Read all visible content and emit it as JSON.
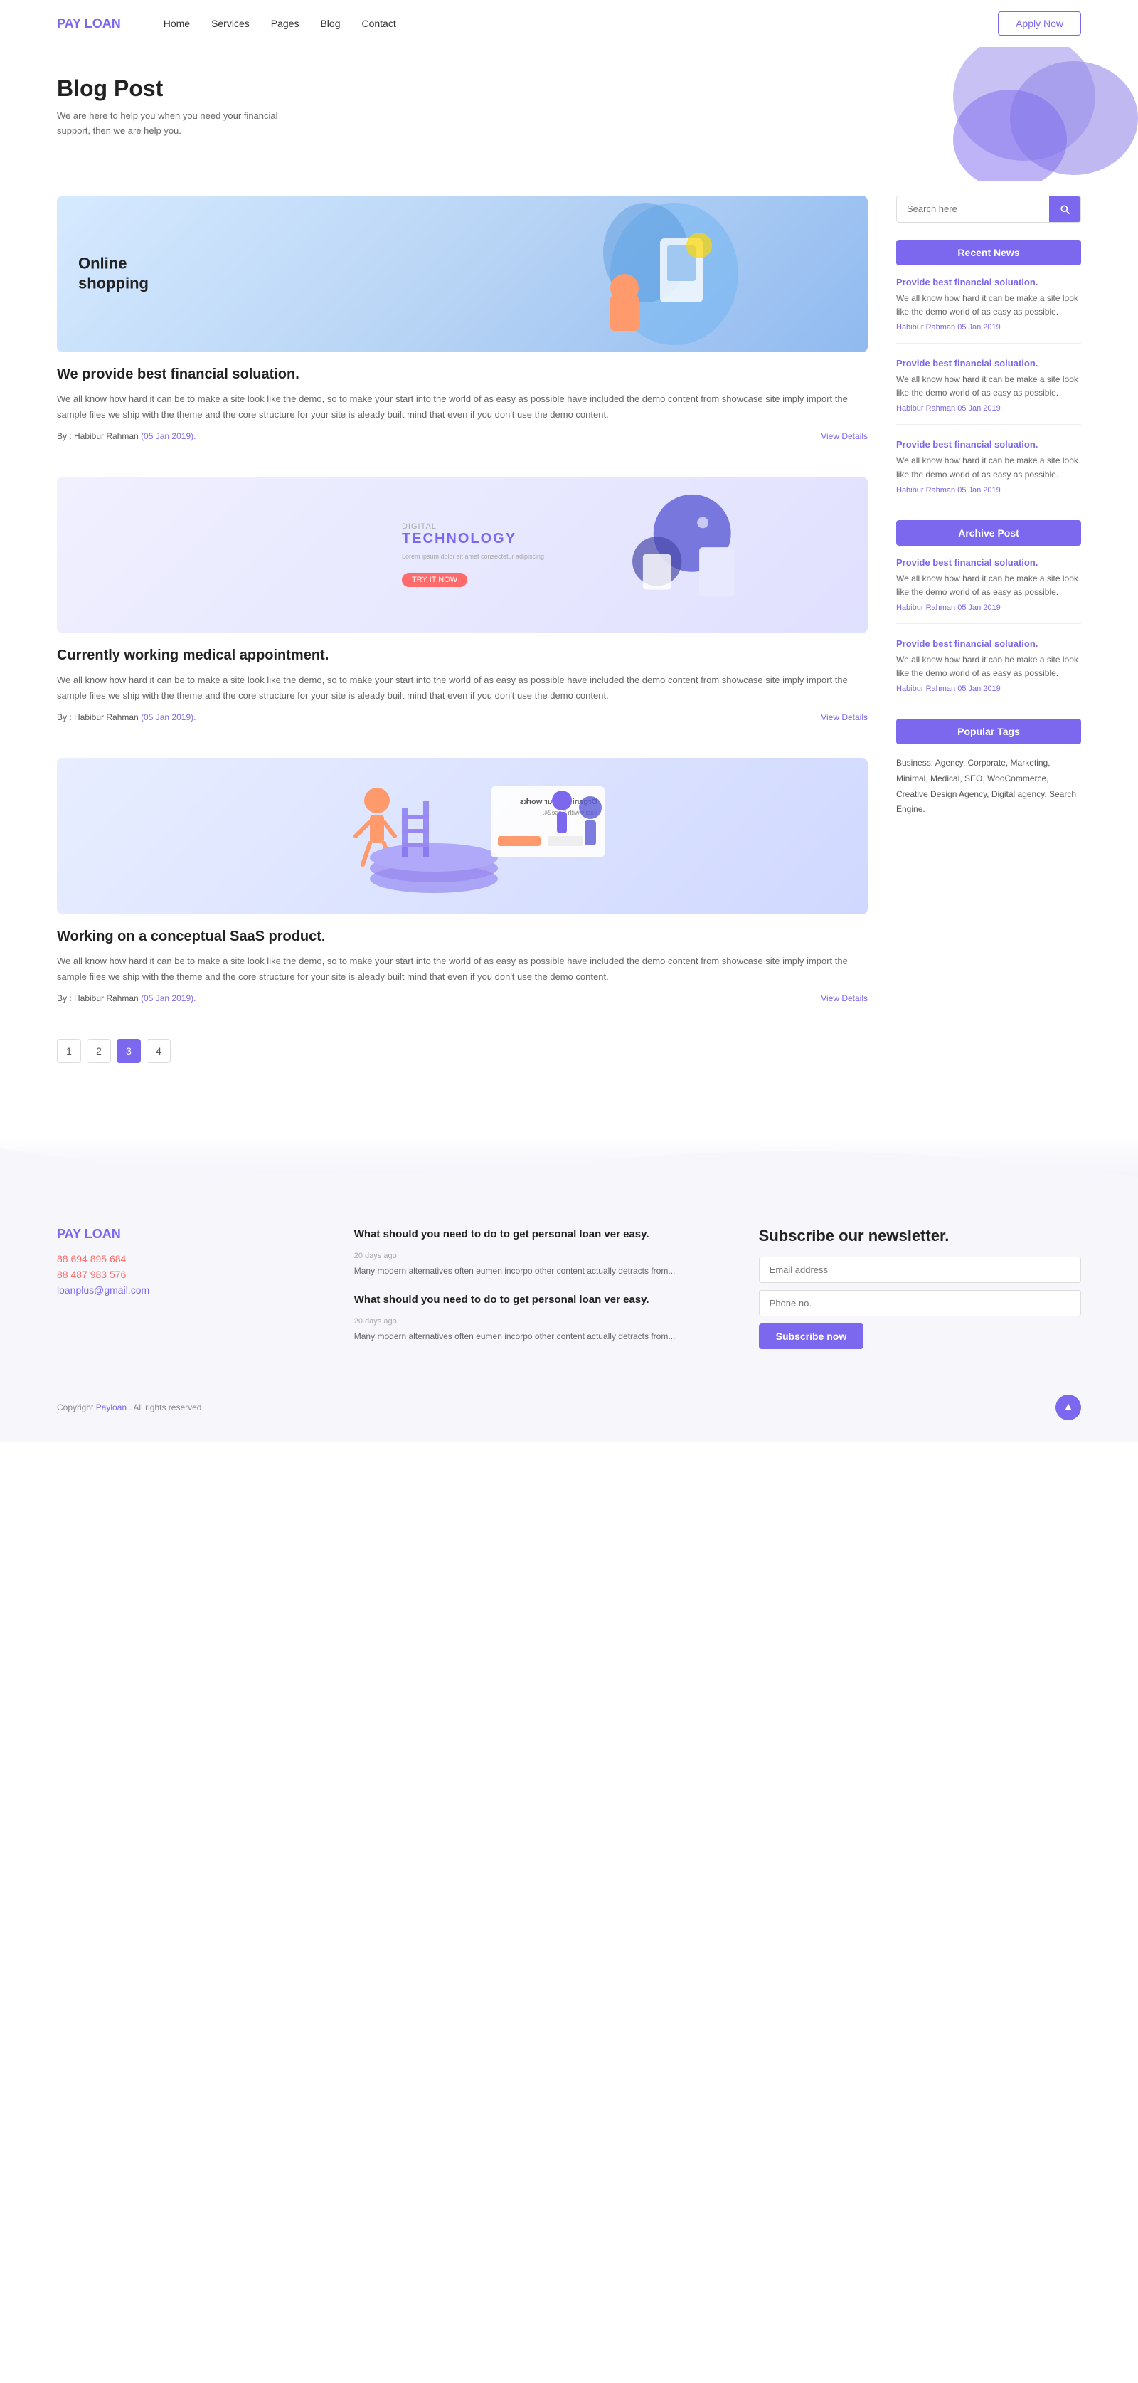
{
  "nav": {
    "logo_pay": "PAY",
    "logo_loan": " LOAN",
    "links": [
      "Home",
      "Services",
      "Pages",
      "Blog",
      "Contact"
    ],
    "apply_btn": "Apply Now"
  },
  "hero": {
    "title": "Blog Post",
    "subtitle": "We are here to help you when you need your financial support, then we are help you."
  },
  "search": {
    "placeholder": "Search here"
  },
  "sidebar": {
    "recent_news_title": "Recent News",
    "archive_post_title": "Archive Post",
    "popular_tags_title": "Popular Tags",
    "popular_tags_text": "Business, Agency, Corporate, Marketing, Minimal, Medical, SEO, WooCommerce, Creative Design Agency, Digital agency, Search Engine.",
    "recent_news": [
      {
        "title": "Provide best financial soluation.",
        "body": "We all know how hard it can be make a site look like the demo world of as easy as possible.",
        "author": "Habibur Rahman",
        "date": "05 Jan 2019"
      },
      {
        "title": "Provide best financial soluation.",
        "body": "We all know how hard it can be make a site look like the demo world of as easy as possible.",
        "author": "Habibur Rahman",
        "date": "05 Jan 2019"
      },
      {
        "title": "Provide best financial soluation.",
        "body": "We all know how hard it can be make a site look like the demo world of as easy as possible.",
        "author": "Habibur Rahman",
        "date": "05 Jan 2019"
      }
    ],
    "archive_posts": [
      {
        "title": "Provide best financial soluation.",
        "body": "We all know how hard it can be make a site look like the demo world of as easy as possible.",
        "author": "Habibur Rahman",
        "date": "05 Jan 2019"
      },
      {
        "title": "Provide best financial soluation.",
        "body": "We all know how hard it can be make a site look like the demo world of as easy as possible.",
        "author": "Habibur Rahman",
        "date": "05 Jan 2019"
      }
    ]
  },
  "posts": [
    {
      "img_type": "img1",
      "img_label": "Online shopping",
      "title": "We provide best financial soluation.",
      "body": "We all know how hard it can be to make a site look like the demo, so to make your start into the world of as easy as possible have included the demo content from showcase site imply import the sample files we ship with the theme and the core structure for your site is aleady built mind that even if you don't use the demo content.",
      "author": "Habibur Rahman",
      "date": "05 Jan 2019",
      "view_details": "View Details"
    },
    {
      "img_type": "img2",
      "img_label": "Digital Technology",
      "title": "Currently working medical appointment.",
      "body": "We all know how hard it can be to make a site look like the demo, so to make your start into the world of as easy as possible have included the demo content from showcase site imply import the sample files we ship with the theme and the core structure for your site is aleady built mind that even if you don't use the demo content.",
      "author": "Habibur Rahman",
      "date": "05 Jan 2019",
      "view_details": "View Details"
    },
    {
      "img_type": "img3",
      "img_label": "Organise your works",
      "title": "Working on a conceptual SaaS product.",
      "body": "We all know how hard it can be to make a site look like the demo, so to make your start into the world of as easy as possible have included the demo content from showcase site imply import the sample files we ship with the theme and the core structure for your site is aleady built mind that even if you don't use the demo content.",
      "author": "Habibur Rahman",
      "date": "05 Jan 2019",
      "view_details": "View Details"
    }
  ],
  "pagination": {
    "pages": [
      "1",
      "2",
      "3",
      "4"
    ],
    "active": "3"
  },
  "footer": {
    "logo_pay": "PAY",
    "logo_loan": " LOAN",
    "phone1": "88 694 895 684",
    "phone2": "88 487 983 576",
    "email": "loanplus@gmail.com",
    "news_col_title1": "What should you need to do to get personal loan ver easy.",
    "news_date1": "20 days ago",
    "news_body1": "Many modern alternatives often eumen incorpo other content actually detracts from...",
    "news_col_title2": "What should you need to do to get personal loan ver easy.",
    "news_date2": "20 days ago",
    "news_body2": "Many modern alternatives often eumen incorpo other content actually detracts from...",
    "newsletter_title": "Subscribe our newsletter.",
    "email_placeholder": "Email address",
    "phone_placeholder": "Phone no.",
    "subscribe_btn": "Subscribe now",
    "copyright": "Copyright",
    "copyright_link": "Payloan",
    "copyright_end": ". All rights reserved"
  }
}
